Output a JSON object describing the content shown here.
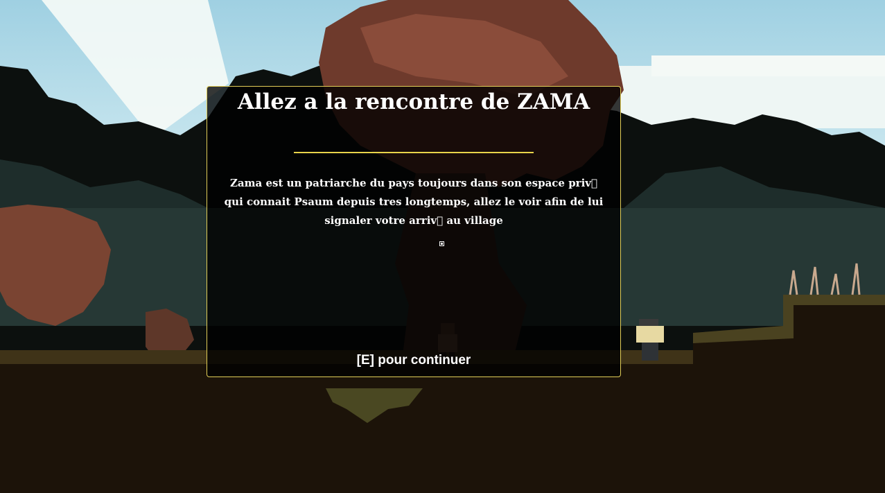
{
  "dialog": {
    "title": "Allez a la rencontre de ZAMA",
    "body": "Zama est un patriarche du pays toujours dans son espace priv\u0000 qui connait Psaum depuis tres longtemps, allez le voir afin de lui signaler votre arriv\u0000 au village",
    "prompt": "[E] pour continuer"
  },
  "colors": {
    "accent": "#e8d44a",
    "sky": "#a9d7e6",
    "ground": "#1c1309",
    "foliage": "#243836",
    "bark": "#7a4432"
  }
}
